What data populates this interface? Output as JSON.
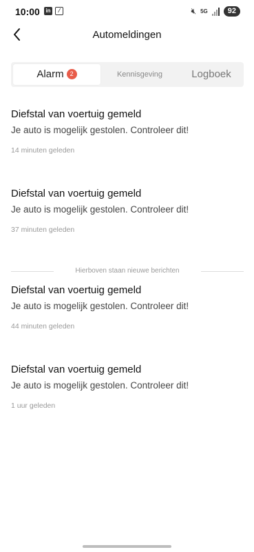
{
  "status_bar": {
    "time": "10:00",
    "icons_left": [
      "linkedin-icon",
      "notification-icon"
    ],
    "icons_right": [
      "mute-icon",
      "5g-icon",
      "signal-icon"
    ],
    "network": "5G",
    "battery": "92"
  },
  "header": {
    "back_icon": "chevron-left-icon",
    "title": "Automeldingen"
  },
  "tabs": [
    {
      "label": "Alarm",
      "badge": "2",
      "active": true
    },
    {
      "label": "Kennisgeving",
      "active": false
    },
    {
      "label": "Logboek",
      "active": false
    }
  ],
  "messages": [
    {
      "title": "Diefstal van voertuig gemeld",
      "body": "Je auto is mogelijk gestolen. Controleer dit!",
      "time": "14 minuten geleden"
    },
    {
      "title": "Diefstal van voertuig gemeld",
      "body": "Je auto is mogelijk gestolen. Controleer dit!",
      "time": "37 minuten geleden"
    },
    {
      "title": "Diefstal van voertuig gemeld",
      "body": "Je auto is mogelijk gestolen. Controleer dit!",
      "time": "44 minuten geleden"
    },
    {
      "title": "Diefstal van voertuig gemeld",
      "body": "Je auto is mogelijk gestolen. Controleer dit!",
      "time": "1 uur geleden"
    }
  ],
  "divider_text": "Hierboven staan nieuwe berichten",
  "colors": {
    "badge": "#e85c4a",
    "tab_bg": "#f2f2f2"
  }
}
